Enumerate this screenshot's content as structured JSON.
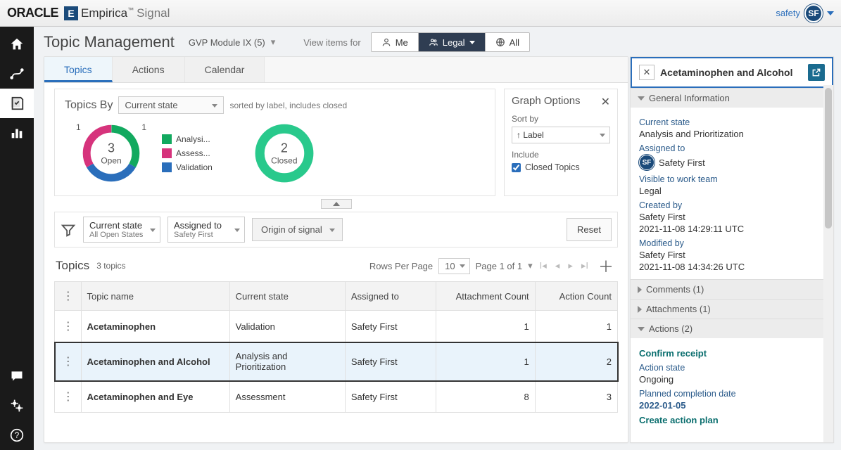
{
  "brand": {
    "oracle": "ORACLE",
    "e": "E",
    "empirica": "Empirica",
    "signal": "Signal"
  },
  "user": {
    "name": "safety",
    "initials": "SF"
  },
  "page": {
    "title": "Topic Management",
    "module": "GVP Module IX (5)",
    "view_label": "View items for",
    "seg_me": "Me",
    "seg_legal": "Legal",
    "seg_all": "All"
  },
  "tabs": {
    "topics": "Topics",
    "actions": "Actions",
    "calendar": "Calendar"
  },
  "chart": {
    "by_label": "Topics By",
    "group_dd": "Current state",
    "sort_note": "sorted by label, includes closed",
    "open_n": "3",
    "open_l": "Open",
    "closed_n": "2",
    "closed_l": "Closed",
    "left1": "1",
    "right1": "1",
    "leg1": "Analysi...",
    "leg2": "Assess...",
    "leg3": "Validation"
  },
  "chart_data": {
    "type": "pie",
    "title": "Topics By Current state",
    "open": {
      "total": 3,
      "slices": [
        {
          "name": "Analysis",
          "value": 1,
          "color": "#12a95f"
        },
        {
          "name": "Assessment",
          "value": 1,
          "color": "#d6337c"
        },
        {
          "name": "Validation",
          "value": 1,
          "color": "#2a6ebb"
        }
      ]
    },
    "closed": {
      "total": 2,
      "slices": [
        {
          "name": "Closed",
          "value": 2,
          "color": "#29c98c"
        }
      ]
    }
  },
  "opts": {
    "title": "Graph Options",
    "sort": "Sort by",
    "sort_val": "Label",
    "include": "Include",
    "closed": "Closed Topics"
  },
  "filters": {
    "f1_t": "Current state",
    "f1_s": "All Open States",
    "f2_t": "Assigned to",
    "f2_s": "Safety First",
    "origin": "Origin of signal",
    "reset": "Reset"
  },
  "table": {
    "title": "Topics",
    "count": "3 topics",
    "rpp": "Rows Per Page",
    "rpp_v": "10",
    "page": "Page 1 of 1",
    "cols": {
      "name": "Topic name",
      "state": "Current state",
      "assigned": "Assigned to",
      "att": "Attachment Count",
      "act": "Action Count"
    },
    "rows": [
      {
        "name": "Acetaminophen",
        "state": "Validation",
        "assigned": "Safety First",
        "att": "1",
        "act": "1",
        "sel": false
      },
      {
        "name": "Acetaminophen and Alcohol",
        "state": "Analysis and Prioritization",
        "assigned": "Safety First",
        "att": "1",
        "act": "2",
        "sel": true
      },
      {
        "name": "Acetaminophen and Eye",
        "state": "Assessment",
        "assigned": "Safety First",
        "att": "8",
        "act": "3",
        "sel": false
      }
    ]
  },
  "panel": {
    "title": "Acetaminophen and Alcohol",
    "gi": "General Information",
    "cs_l": "Current state",
    "cs_v": "Analysis and Prioritization",
    "as_l": "Assigned to",
    "as_v": "Safety First",
    "wt_l": "Visible to work team",
    "wt_v": "Legal",
    "cb_l": "Created by",
    "cb_v": "Safety First",
    "cb_d": "2021-11-08 14:29:11 UTC",
    "mb_l": "Modified by",
    "mb_v": "Safety First",
    "mb_d": "2021-11-08 14:34:26 UTC",
    "comments": "Comments (1)",
    "atts": "Attachments (1)",
    "actions": "Actions (2)",
    "a1": "Confirm receipt",
    "a_state_l": "Action state",
    "a_state_v": "Ongoing",
    "a_pcd_l": "Planned completion date",
    "a_pcd_v": "2022-01-05",
    "a2": "Create action plan"
  }
}
